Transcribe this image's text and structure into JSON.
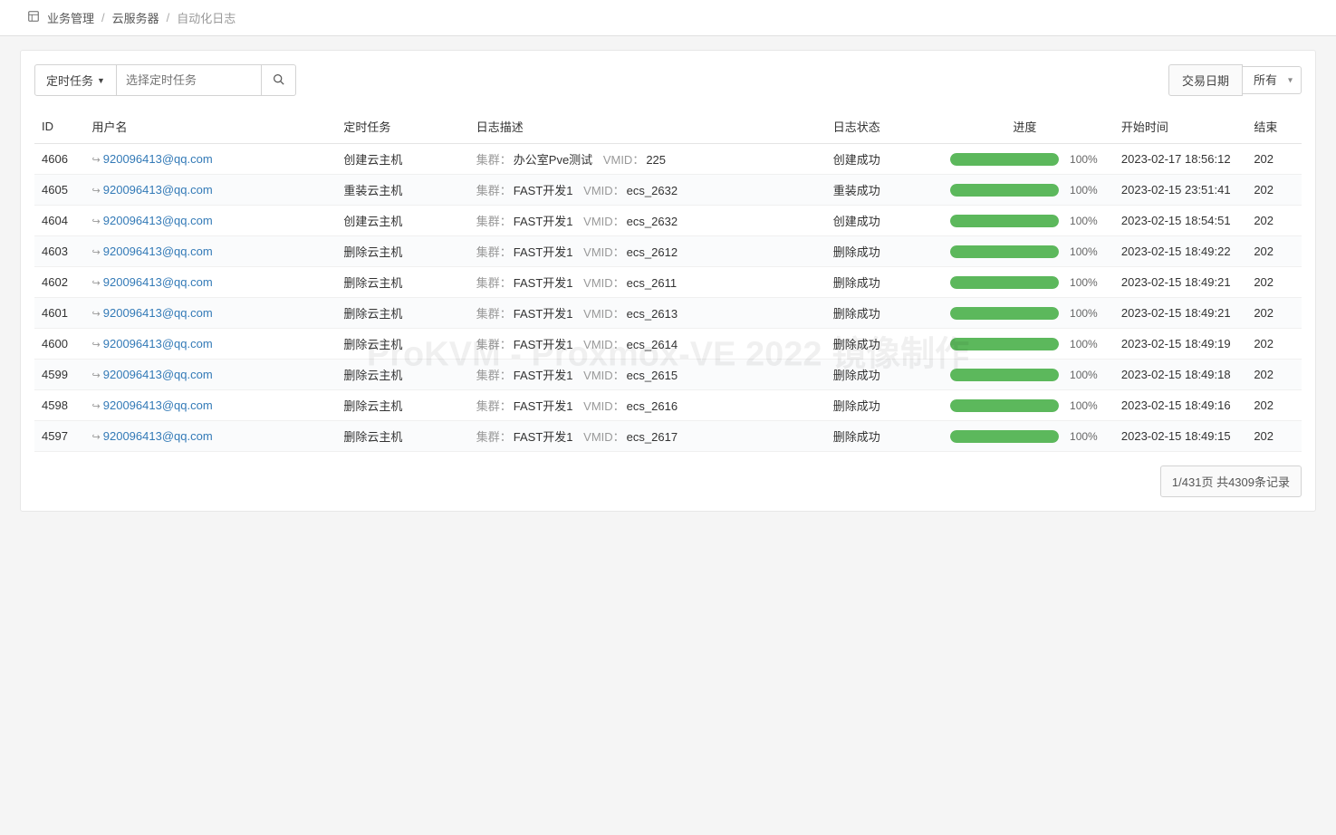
{
  "breadcrumb": {
    "item1": "业务管理",
    "item2": "云服务器",
    "item3": "自动化日志"
  },
  "toolbar": {
    "filter_label": "定时任务",
    "filter_placeholder": "选择定时任务",
    "date_label": "交易日期",
    "date_value": "所有"
  },
  "columns": {
    "id": "ID",
    "username": "用户名",
    "task": "定时任务",
    "desc": "日志描述",
    "status": "日志状态",
    "progress": "进度",
    "start": "开始时间",
    "end": "结束"
  },
  "desc_labels": {
    "cluster": "集群：",
    "vmid": "VMID："
  },
  "rows": [
    {
      "id": "4606",
      "user": "920096413@qq.com",
      "task": "创建云主机",
      "cluster": "办公室Pve测试",
      "vmid": "225",
      "status": "创建成功",
      "progress": 100,
      "start": "2023-02-17 18:56:12",
      "end": "202"
    },
    {
      "id": "4605",
      "user": "920096413@qq.com",
      "task": "重装云主机",
      "cluster": "FAST开发1",
      "vmid": "ecs_2632",
      "status": "重装成功",
      "progress": 100,
      "start": "2023-02-15 23:51:41",
      "end": "202"
    },
    {
      "id": "4604",
      "user": "920096413@qq.com",
      "task": "创建云主机",
      "cluster": "FAST开发1",
      "vmid": "ecs_2632",
      "status": "创建成功",
      "progress": 100,
      "start": "2023-02-15 18:54:51",
      "end": "202"
    },
    {
      "id": "4603",
      "user": "920096413@qq.com",
      "task": "删除云主机",
      "cluster": "FAST开发1",
      "vmid": "ecs_2612",
      "status": "删除成功",
      "progress": 100,
      "start": "2023-02-15 18:49:22",
      "end": "202"
    },
    {
      "id": "4602",
      "user": "920096413@qq.com",
      "task": "删除云主机",
      "cluster": "FAST开发1",
      "vmid": "ecs_2611",
      "status": "删除成功",
      "progress": 100,
      "start": "2023-02-15 18:49:21",
      "end": "202"
    },
    {
      "id": "4601",
      "user": "920096413@qq.com",
      "task": "删除云主机",
      "cluster": "FAST开发1",
      "vmid": "ecs_2613",
      "status": "删除成功",
      "progress": 100,
      "start": "2023-02-15 18:49:21",
      "end": "202"
    },
    {
      "id": "4600",
      "user": "920096413@qq.com",
      "task": "删除云主机",
      "cluster": "FAST开发1",
      "vmid": "ecs_2614",
      "status": "删除成功",
      "progress": 100,
      "start": "2023-02-15 18:49:19",
      "end": "202"
    },
    {
      "id": "4599",
      "user": "920096413@qq.com",
      "task": "删除云主机",
      "cluster": "FAST开发1",
      "vmid": "ecs_2615",
      "status": "删除成功",
      "progress": 100,
      "start": "2023-02-15 18:49:18",
      "end": "202"
    },
    {
      "id": "4598",
      "user": "920096413@qq.com",
      "task": "删除云主机",
      "cluster": "FAST开发1",
      "vmid": "ecs_2616",
      "status": "删除成功",
      "progress": 100,
      "start": "2023-02-15 18:49:16",
      "end": "202"
    },
    {
      "id": "4597",
      "user": "920096413@qq.com",
      "task": "删除云主机",
      "cluster": "FAST开发1",
      "vmid": "ecs_2617",
      "status": "删除成功",
      "progress": 100,
      "start": "2023-02-15 18:49:15",
      "end": "202"
    }
  ],
  "pagination": {
    "info": "1/431页 共4309条记录"
  },
  "watermark": "ProKVM - Proxmox-VE 2022 镜像制作"
}
